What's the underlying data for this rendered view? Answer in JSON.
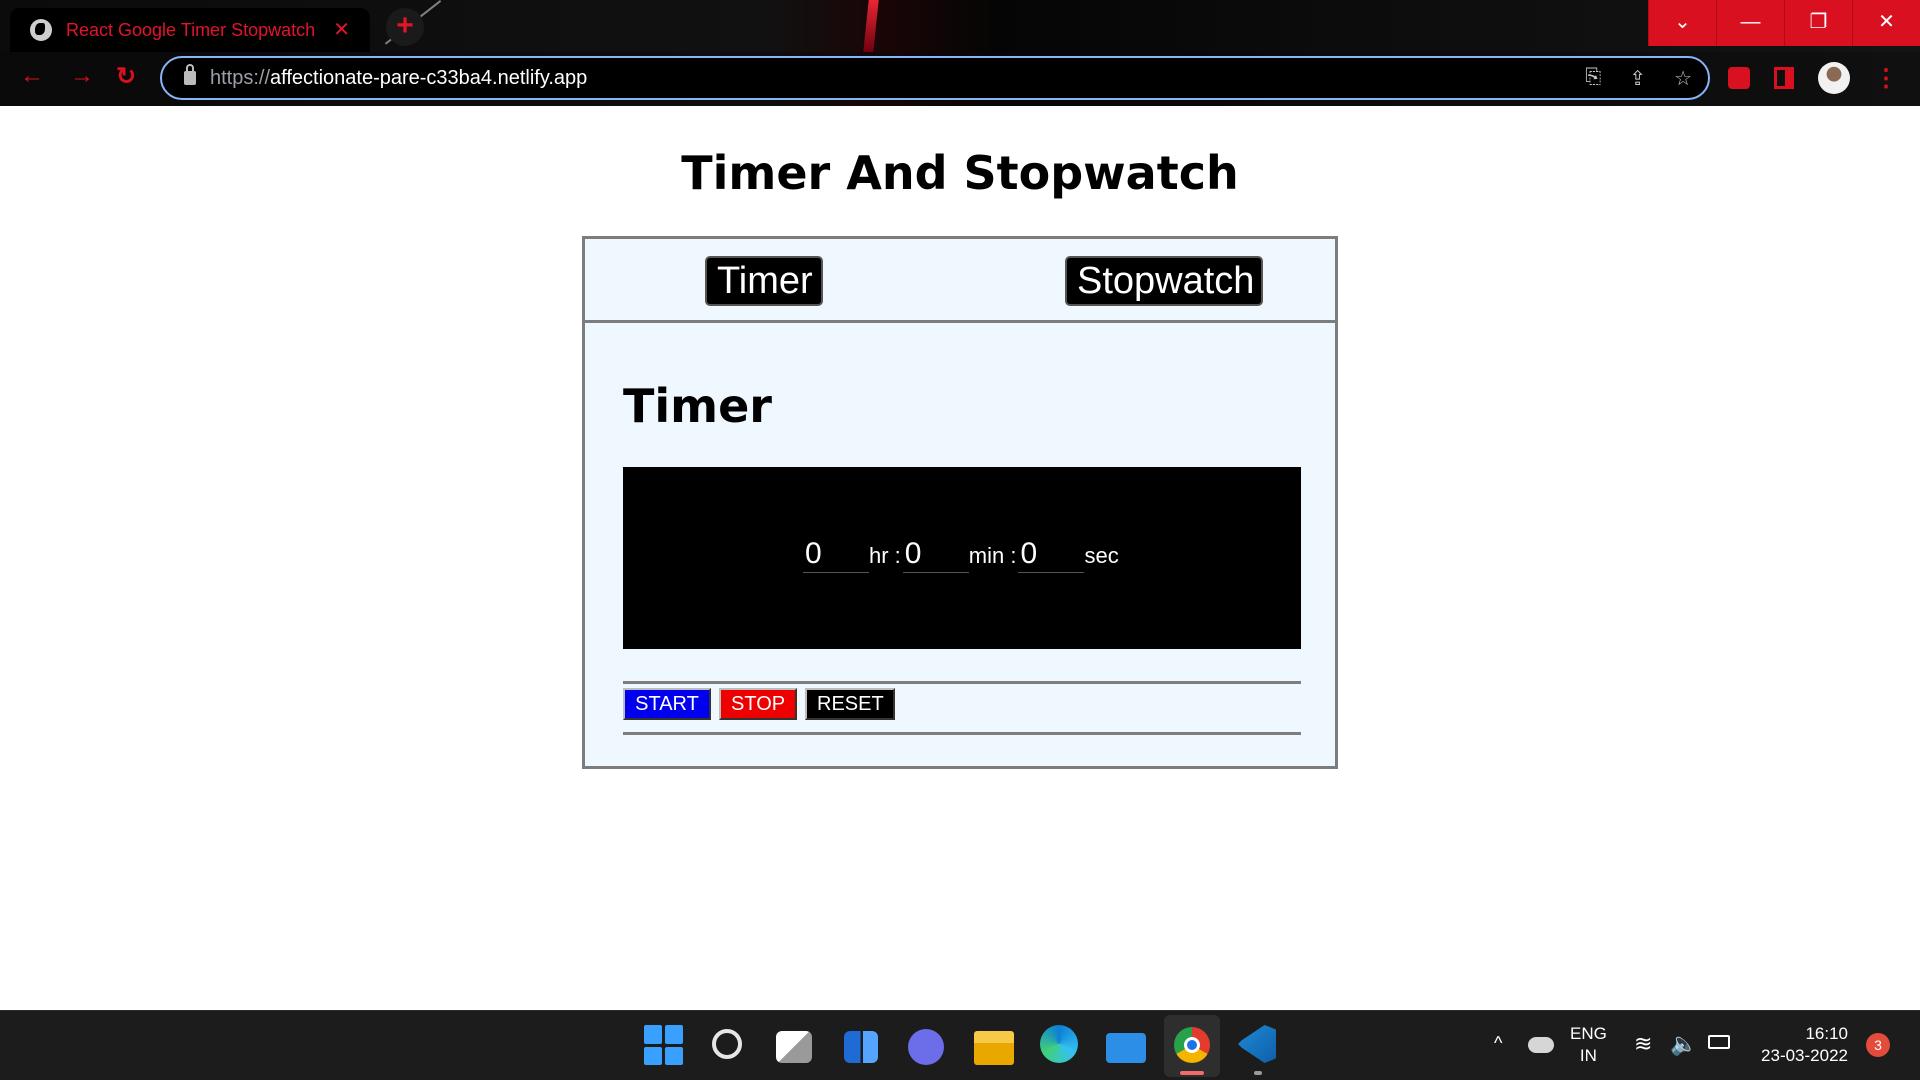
{
  "browser": {
    "tab_title": "React Google Timer Stopwatch",
    "tab_close": "✕",
    "new_tab": "+",
    "url_scheme": "https://",
    "url_host": "affectionate-pare-c33ba4.netlify.app",
    "window_buttons": [
      "⌄",
      "—",
      "❐",
      "✕"
    ]
  },
  "page": {
    "title": "Timer And Stopwatch",
    "tabs": [
      {
        "label": "Timer"
      },
      {
        "label": "Stopwatch"
      }
    ],
    "section_title": "Timer",
    "timer": {
      "hours_value": "0",
      "hours_unit": "hr :",
      "minutes_value": "0",
      "minutes_unit": "min :",
      "seconds_value": "0",
      "seconds_unit": "sec"
    },
    "controls": {
      "start": "START",
      "stop": "STOP",
      "reset": "RESET"
    },
    "colors": {
      "start": "#0000ee",
      "stop": "#ee0000",
      "reset": "#000000",
      "card_bg": "#eff7ff",
      "accent": "#d8101f"
    }
  },
  "taskbar": {
    "lang_top": "ENG",
    "lang_bottom": "IN",
    "time": "16:10",
    "date": "23-03-2022",
    "notification_count": "3"
  }
}
